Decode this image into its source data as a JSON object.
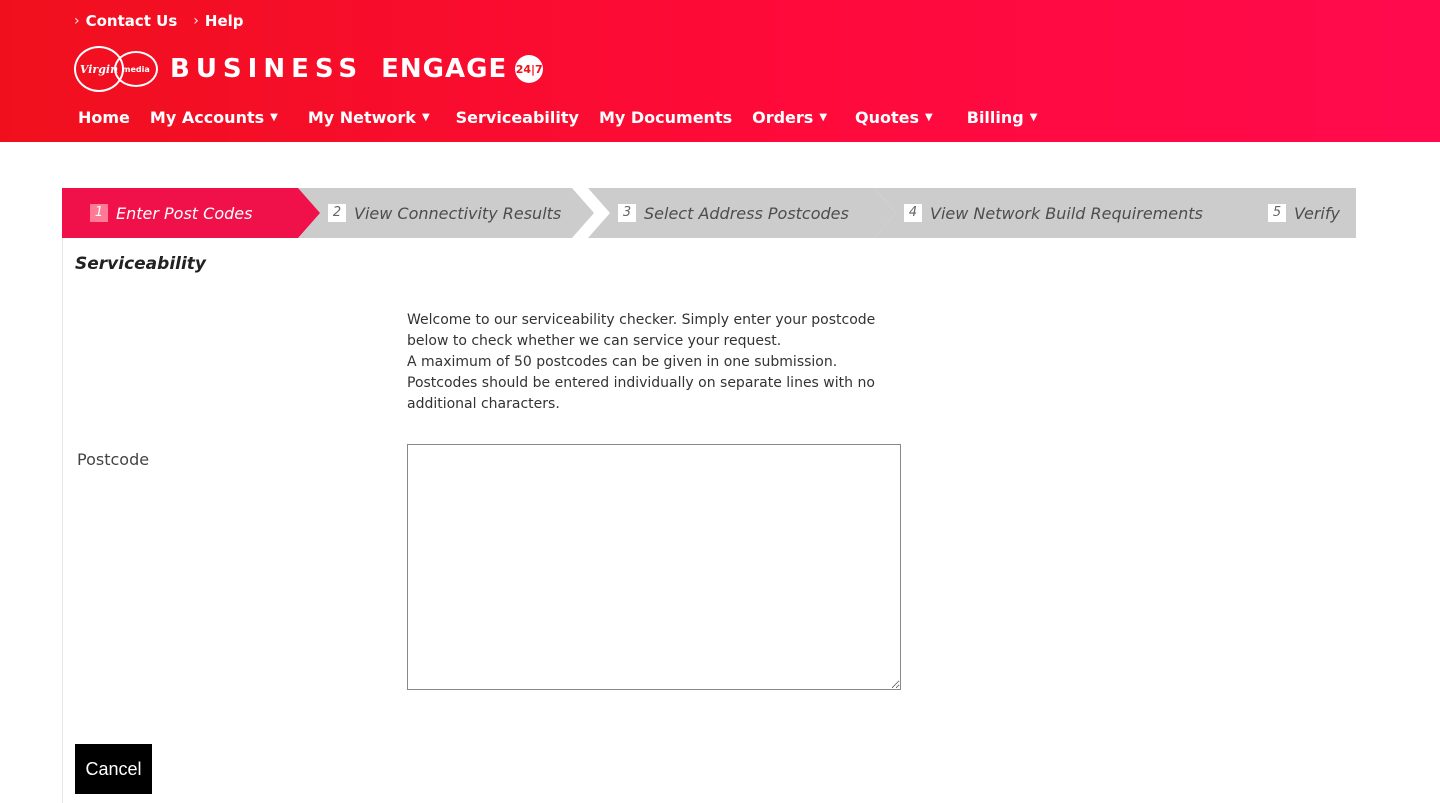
{
  "utility_links": [
    {
      "label": "Contact Us"
    },
    {
      "label": "Help"
    }
  ],
  "brand": {
    "logo_text": "Virgin",
    "logo_media_text": "media",
    "name": "BUSINESS",
    "product": "ENGAGE",
    "badge": "24|7"
  },
  "nav": {
    "home": "Home",
    "my_accounts": "My Accounts",
    "my_network": "My Network",
    "serviceability": "Serviceability",
    "my_documents": "My Documents",
    "orders": "Orders",
    "quotes": "Quotes",
    "billing": "Billing"
  },
  "wizard": {
    "steps": [
      {
        "number": "1",
        "label": "Enter Post Codes",
        "active": true
      },
      {
        "number": "2",
        "label": "View Connectivity Results",
        "active": false
      },
      {
        "number": "3",
        "label": "Select Address Postcodes",
        "active": false
      },
      {
        "number": "4",
        "label": "View Network Build Requirements",
        "active": false
      },
      {
        "number": "5",
        "label": "Verify",
        "active": false
      }
    ]
  },
  "main": {
    "title": "Serviceability",
    "intro_lines": [
      "Welcome to our serviceability checker. Simply enter your postcode",
      "below to check whether we can service your request.",
      "A maximum of 50 postcodes can be given in one submission.",
      "Postcodes should be entered individually on separate lines with no",
      "additional characters."
    ],
    "postcode_label": "Postcode",
    "postcode_value": "",
    "cancel_label": "Cancel"
  },
  "colors": {
    "brand_red": "#f0101d",
    "active_step": "#f0104a",
    "inactive_step": "#cccccc"
  }
}
